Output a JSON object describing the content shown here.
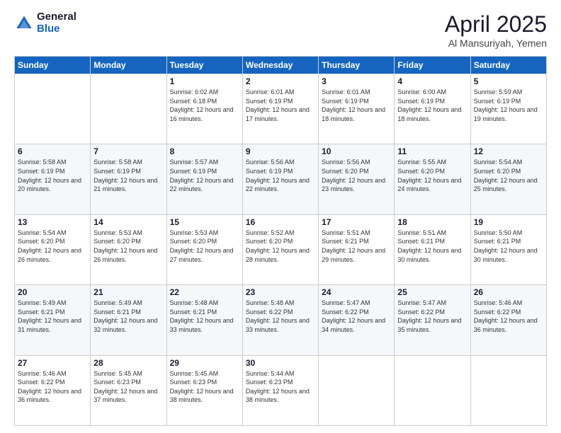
{
  "logo": {
    "general": "General",
    "blue": "Blue"
  },
  "title": {
    "month": "April 2025",
    "location": "Al Mansuriyah, Yemen"
  },
  "weekdays": [
    "Sunday",
    "Monday",
    "Tuesday",
    "Wednesday",
    "Thursday",
    "Friday",
    "Saturday"
  ],
  "weeks": [
    [
      {
        "day": "",
        "info": ""
      },
      {
        "day": "",
        "info": ""
      },
      {
        "day": "1",
        "info": "Sunrise: 6:02 AM\nSunset: 6:18 PM\nDaylight: 12 hours and 16 minutes."
      },
      {
        "day": "2",
        "info": "Sunrise: 6:01 AM\nSunset: 6:19 PM\nDaylight: 12 hours and 17 minutes."
      },
      {
        "day": "3",
        "info": "Sunrise: 6:01 AM\nSunset: 6:19 PM\nDaylight: 12 hours and 18 minutes."
      },
      {
        "day": "4",
        "info": "Sunrise: 6:00 AM\nSunset: 6:19 PM\nDaylight: 12 hours and 18 minutes."
      },
      {
        "day": "5",
        "info": "Sunrise: 5:59 AM\nSunset: 6:19 PM\nDaylight: 12 hours and 19 minutes."
      }
    ],
    [
      {
        "day": "6",
        "info": "Sunrise: 5:58 AM\nSunset: 6:19 PM\nDaylight: 12 hours and 20 minutes."
      },
      {
        "day": "7",
        "info": "Sunrise: 5:58 AM\nSunset: 6:19 PM\nDaylight: 12 hours and 21 minutes."
      },
      {
        "day": "8",
        "info": "Sunrise: 5:57 AM\nSunset: 6:19 PM\nDaylight: 12 hours and 22 minutes."
      },
      {
        "day": "9",
        "info": "Sunrise: 5:56 AM\nSunset: 6:19 PM\nDaylight: 12 hours and 22 minutes."
      },
      {
        "day": "10",
        "info": "Sunrise: 5:56 AM\nSunset: 6:20 PM\nDaylight: 12 hours and 23 minutes."
      },
      {
        "day": "11",
        "info": "Sunrise: 5:55 AM\nSunset: 6:20 PM\nDaylight: 12 hours and 24 minutes."
      },
      {
        "day": "12",
        "info": "Sunrise: 5:54 AM\nSunset: 6:20 PM\nDaylight: 12 hours and 25 minutes."
      }
    ],
    [
      {
        "day": "13",
        "info": "Sunrise: 5:54 AM\nSunset: 6:20 PM\nDaylight: 12 hours and 26 minutes."
      },
      {
        "day": "14",
        "info": "Sunrise: 5:53 AM\nSunset: 6:20 PM\nDaylight: 12 hours and 26 minutes."
      },
      {
        "day": "15",
        "info": "Sunrise: 5:53 AM\nSunset: 6:20 PM\nDaylight: 12 hours and 27 minutes."
      },
      {
        "day": "16",
        "info": "Sunrise: 5:52 AM\nSunset: 6:20 PM\nDaylight: 12 hours and 28 minutes."
      },
      {
        "day": "17",
        "info": "Sunrise: 5:51 AM\nSunset: 6:21 PM\nDaylight: 12 hours and 29 minutes."
      },
      {
        "day": "18",
        "info": "Sunrise: 5:51 AM\nSunset: 6:21 PM\nDaylight: 12 hours and 30 minutes."
      },
      {
        "day": "19",
        "info": "Sunrise: 5:50 AM\nSunset: 6:21 PM\nDaylight: 12 hours and 30 minutes."
      }
    ],
    [
      {
        "day": "20",
        "info": "Sunrise: 5:49 AM\nSunset: 6:21 PM\nDaylight: 12 hours and 31 minutes."
      },
      {
        "day": "21",
        "info": "Sunrise: 5:49 AM\nSunset: 6:21 PM\nDaylight: 12 hours and 32 minutes."
      },
      {
        "day": "22",
        "info": "Sunrise: 5:48 AM\nSunset: 6:21 PM\nDaylight: 12 hours and 33 minutes."
      },
      {
        "day": "23",
        "info": "Sunrise: 5:48 AM\nSunset: 6:22 PM\nDaylight: 12 hours and 33 minutes."
      },
      {
        "day": "24",
        "info": "Sunrise: 5:47 AM\nSunset: 6:22 PM\nDaylight: 12 hours and 34 minutes."
      },
      {
        "day": "25",
        "info": "Sunrise: 5:47 AM\nSunset: 6:22 PM\nDaylight: 12 hours and 35 minutes."
      },
      {
        "day": "26",
        "info": "Sunrise: 5:46 AM\nSunset: 6:22 PM\nDaylight: 12 hours and 36 minutes."
      }
    ],
    [
      {
        "day": "27",
        "info": "Sunrise: 5:46 AM\nSunset: 6:22 PM\nDaylight: 12 hours and 36 minutes."
      },
      {
        "day": "28",
        "info": "Sunrise: 5:45 AM\nSunset: 6:23 PM\nDaylight: 12 hours and 37 minutes."
      },
      {
        "day": "29",
        "info": "Sunrise: 5:45 AM\nSunset: 6:23 PM\nDaylight: 12 hours and 38 minutes."
      },
      {
        "day": "30",
        "info": "Sunrise: 5:44 AM\nSunset: 6:23 PM\nDaylight: 12 hours and 38 minutes."
      },
      {
        "day": "",
        "info": ""
      },
      {
        "day": "",
        "info": ""
      },
      {
        "day": "",
        "info": ""
      }
    ]
  ]
}
